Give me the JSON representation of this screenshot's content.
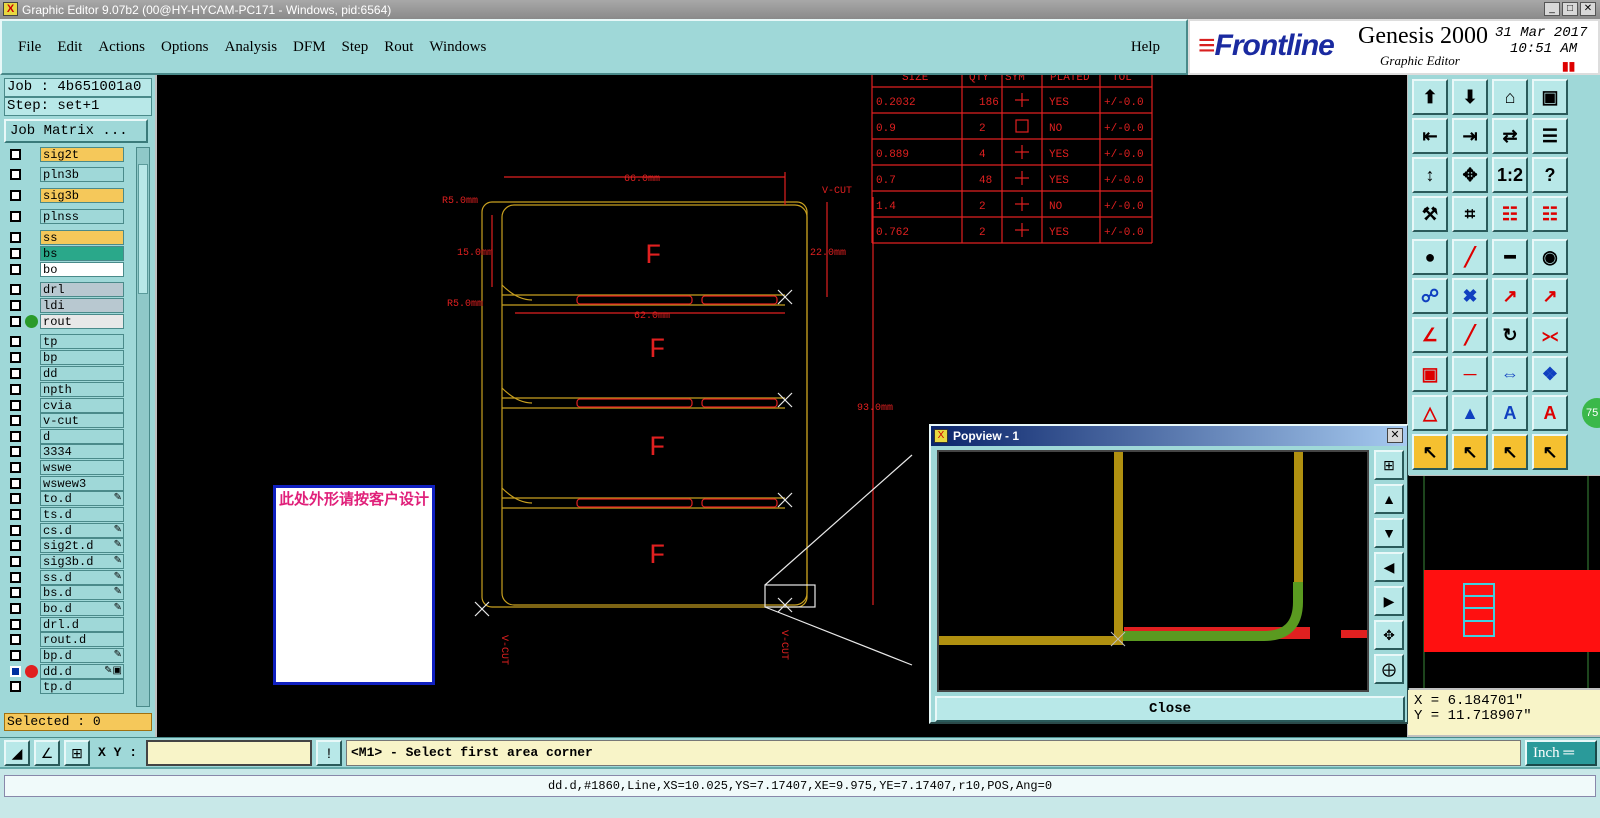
{
  "window": {
    "title": "Graphic Editor 9.07b2 (00@HY-HYCAM-PC171 - Windows, pid:6564)"
  },
  "menu": [
    "File",
    "Edit",
    "Actions",
    "Options",
    "Analysis",
    "DFM",
    "Step",
    "Rout",
    "Windows"
  ],
  "help_label": "Help",
  "brand": {
    "logo": "Frontline",
    "product": "Genesis 2000",
    "subtitle": "Graphic Editor",
    "date": "31 Mar 2017",
    "time": "10:51 AM"
  },
  "job": {
    "job_line": "Job : 4b651001a0",
    "step_line": "Step: set+1",
    "job_matrix_button": "Job Matrix ..."
  },
  "layers": [
    {
      "name": "sig2t",
      "color": "#f5c85a"
    },
    {
      "name": "pln3b",
      "color": "#9fd8d8"
    },
    {
      "name": "sig3b",
      "color": "#f5c85a"
    },
    {
      "name": "plnss",
      "color": "#9fd8d8"
    },
    {
      "name": "ss",
      "color": "#f5c85a"
    },
    {
      "name": "bs",
      "color": "#2aa88a"
    },
    {
      "name": "bo",
      "color": "#ffffff"
    },
    {
      "name": "drl",
      "color": "#b8c8d0"
    },
    {
      "name": "ldi",
      "color": "#b8c8d0"
    },
    {
      "name": "rout",
      "color": "#e8e8e8",
      "dot": "#2a9a2a"
    },
    {
      "name": "tp",
      "color": "#9fd8d8"
    },
    {
      "name": "bp",
      "color": "#9fd8d8"
    },
    {
      "name": "dd",
      "color": "#9fd8d8"
    },
    {
      "name": "npth",
      "color": "#9fd8d8"
    },
    {
      "name": "cvia",
      "color": "#9fd8d8"
    },
    {
      "name": "v-cut",
      "color": "#9fd8d8"
    },
    {
      "name": "d",
      "color": "#9fd8d8"
    },
    {
      "name": "3334",
      "color": "#9fd8d8"
    },
    {
      "name": "wswe",
      "color": "#9fd8d8"
    },
    {
      "name": "wswew3",
      "color": "#9fd8d8"
    },
    {
      "name": "to.d",
      "color": "#9fd8d8",
      "mark": "✎"
    },
    {
      "name": "ts.d",
      "color": "#9fd8d8"
    },
    {
      "name": "cs.d",
      "color": "#9fd8d8",
      "mark": "✎"
    },
    {
      "name": "sig2t.d",
      "color": "#9fd8d8",
      "mark": "✎"
    },
    {
      "name": "sig3b.d",
      "color": "#9fd8d8",
      "mark": "✎"
    },
    {
      "name": "ss.d",
      "color": "#9fd8d8",
      "mark": "✎"
    },
    {
      "name": "bs.d",
      "color": "#9fd8d8",
      "mark": "✎"
    },
    {
      "name": "bo.d",
      "color": "#9fd8d8",
      "mark": "✎"
    },
    {
      "name": "drl.d",
      "color": "#9fd8d8"
    },
    {
      "name": "rout.d",
      "color": "#9fd8d8"
    },
    {
      "name": "bp.d",
      "color": "#9fd8d8",
      "mark": "✎"
    },
    {
      "name": "dd.d",
      "color": "#9fd8d8",
      "mark": "✎▣",
      "dot": "#e02020",
      "selected": true
    },
    {
      "name": "tp.d",
      "color": "#9fd8d8"
    }
  ],
  "selected_label": "Selected : 0",
  "drill_table": {
    "headers": [
      "SIZE",
      "QTY",
      "SYM",
      "PLATED",
      "TOL"
    ],
    "rows": [
      [
        "0.2032",
        "186",
        "YES",
        "+/-0.0"
      ],
      [
        "0.9",
        "2",
        "NO",
        "+/-0.0"
      ],
      [
        "0.889",
        "4",
        "YES",
        "+/-0.0"
      ],
      [
        "0.7",
        "48",
        "YES",
        "+/-0.0"
      ],
      [
        "1.4",
        "2",
        "NO",
        "+/-0.0"
      ],
      [
        "0.762",
        "2",
        "YES",
        "+/-0.0"
      ]
    ]
  },
  "dimensions": {
    "width_top": "66.0mm",
    "width_mid": "62.0mm",
    "height_right": "22.0mm",
    "height_total": "93.0mm",
    "left_dim": "15.0mm",
    "r_top": "R5.0mm",
    "r_mid": "R5.0mm",
    "vcut_top": "V-CUT",
    "vcut_bottom_left": "V-CUT",
    "vcut_bottom_right": "V-CUT",
    "panel_letter": "F"
  },
  "note_text": "此处外形请按客户设计",
  "popview": {
    "title": "Popview - 1",
    "close_label": "Close"
  },
  "coords": {
    "x": "X = 6.184701\"",
    "y": "Y = 11.718907\""
  },
  "cmd": {
    "xy_label": "X Y :",
    "xy_value": "",
    "prompt": "<M1> - Select first area corner",
    "unit": "Inch"
  },
  "status": "dd.d,#1860,Line,XS=10.025,YS=7.17407,XE=9.975,YE=7.17407,r10,POS,Ang=0",
  "green_badge": "75",
  "colors": {
    "panel_teal": "#9fd8d8",
    "canvas": "#000000",
    "drawing_red": "#e02020",
    "outline_yellow": "#c8a020",
    "highlight_orange": "#f5c85a"
  }
}
